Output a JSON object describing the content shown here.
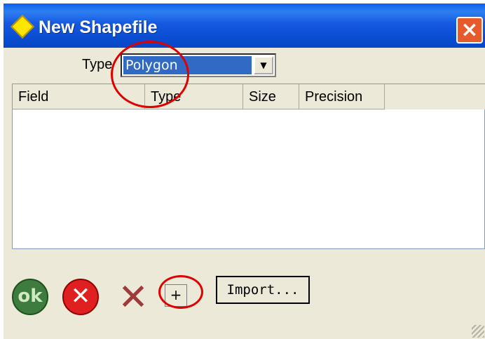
{
  "window": {
    "title": "New Shapefile",
    "close_icon": "close-icon",
    "app_icon": "diamond-icon"
  },
  "type_field": {
    "label": "Type",
    "selected": "Polygon",
    "dropdown_icon": "chevron-down-icon"
  },
  "grid": {
    "columns": [
      "Field",
      "Type",
      "Size",
      "Precision"
    ],
    "rows": []
  },
  "buttons": {
    "ok_label": "ok",
    "cancel_glyph": "✕",
    "delete_glyph": "✕",
    "add_label": "+",
    "import_label": "Import..."
  },
  "colors": {
    "title_bar": "#0a4ed3",
    "dialog_bg": "#ece9d8",
    "selection": "#316ac5",
    "highlight": "#e00000"
  }
}
